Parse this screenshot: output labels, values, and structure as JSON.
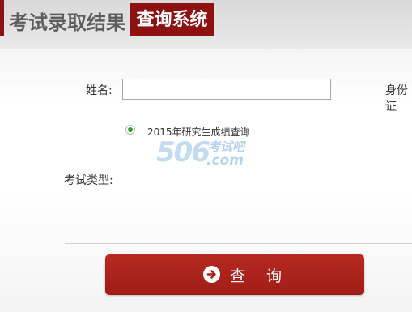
{
  "header": {
    "title": "考试录取结果",
    "tag": "查询系统"
  },
  "form": {
    "name_label": "姓名:",
    "name_value": "",
    "id_label": "身份证",
    "radio_option": "2015年研究生成绩查询",
    "exam_type_label": "考试类型:"
  },
  "watermark": {
    "number": "506",
    "text": "考试吧",
    "domain": ".com"
  },
  "buttons": {
    "query_label": "查 询"
  },
  "icons": {
    "query_button_icon": "arrow-right-circle-icon"
  },
  "colors": {
    "brand_red": "#8e1111",
    "button_red": "#b52a22",
    "radio_green": "#27a12a"
  }
}
